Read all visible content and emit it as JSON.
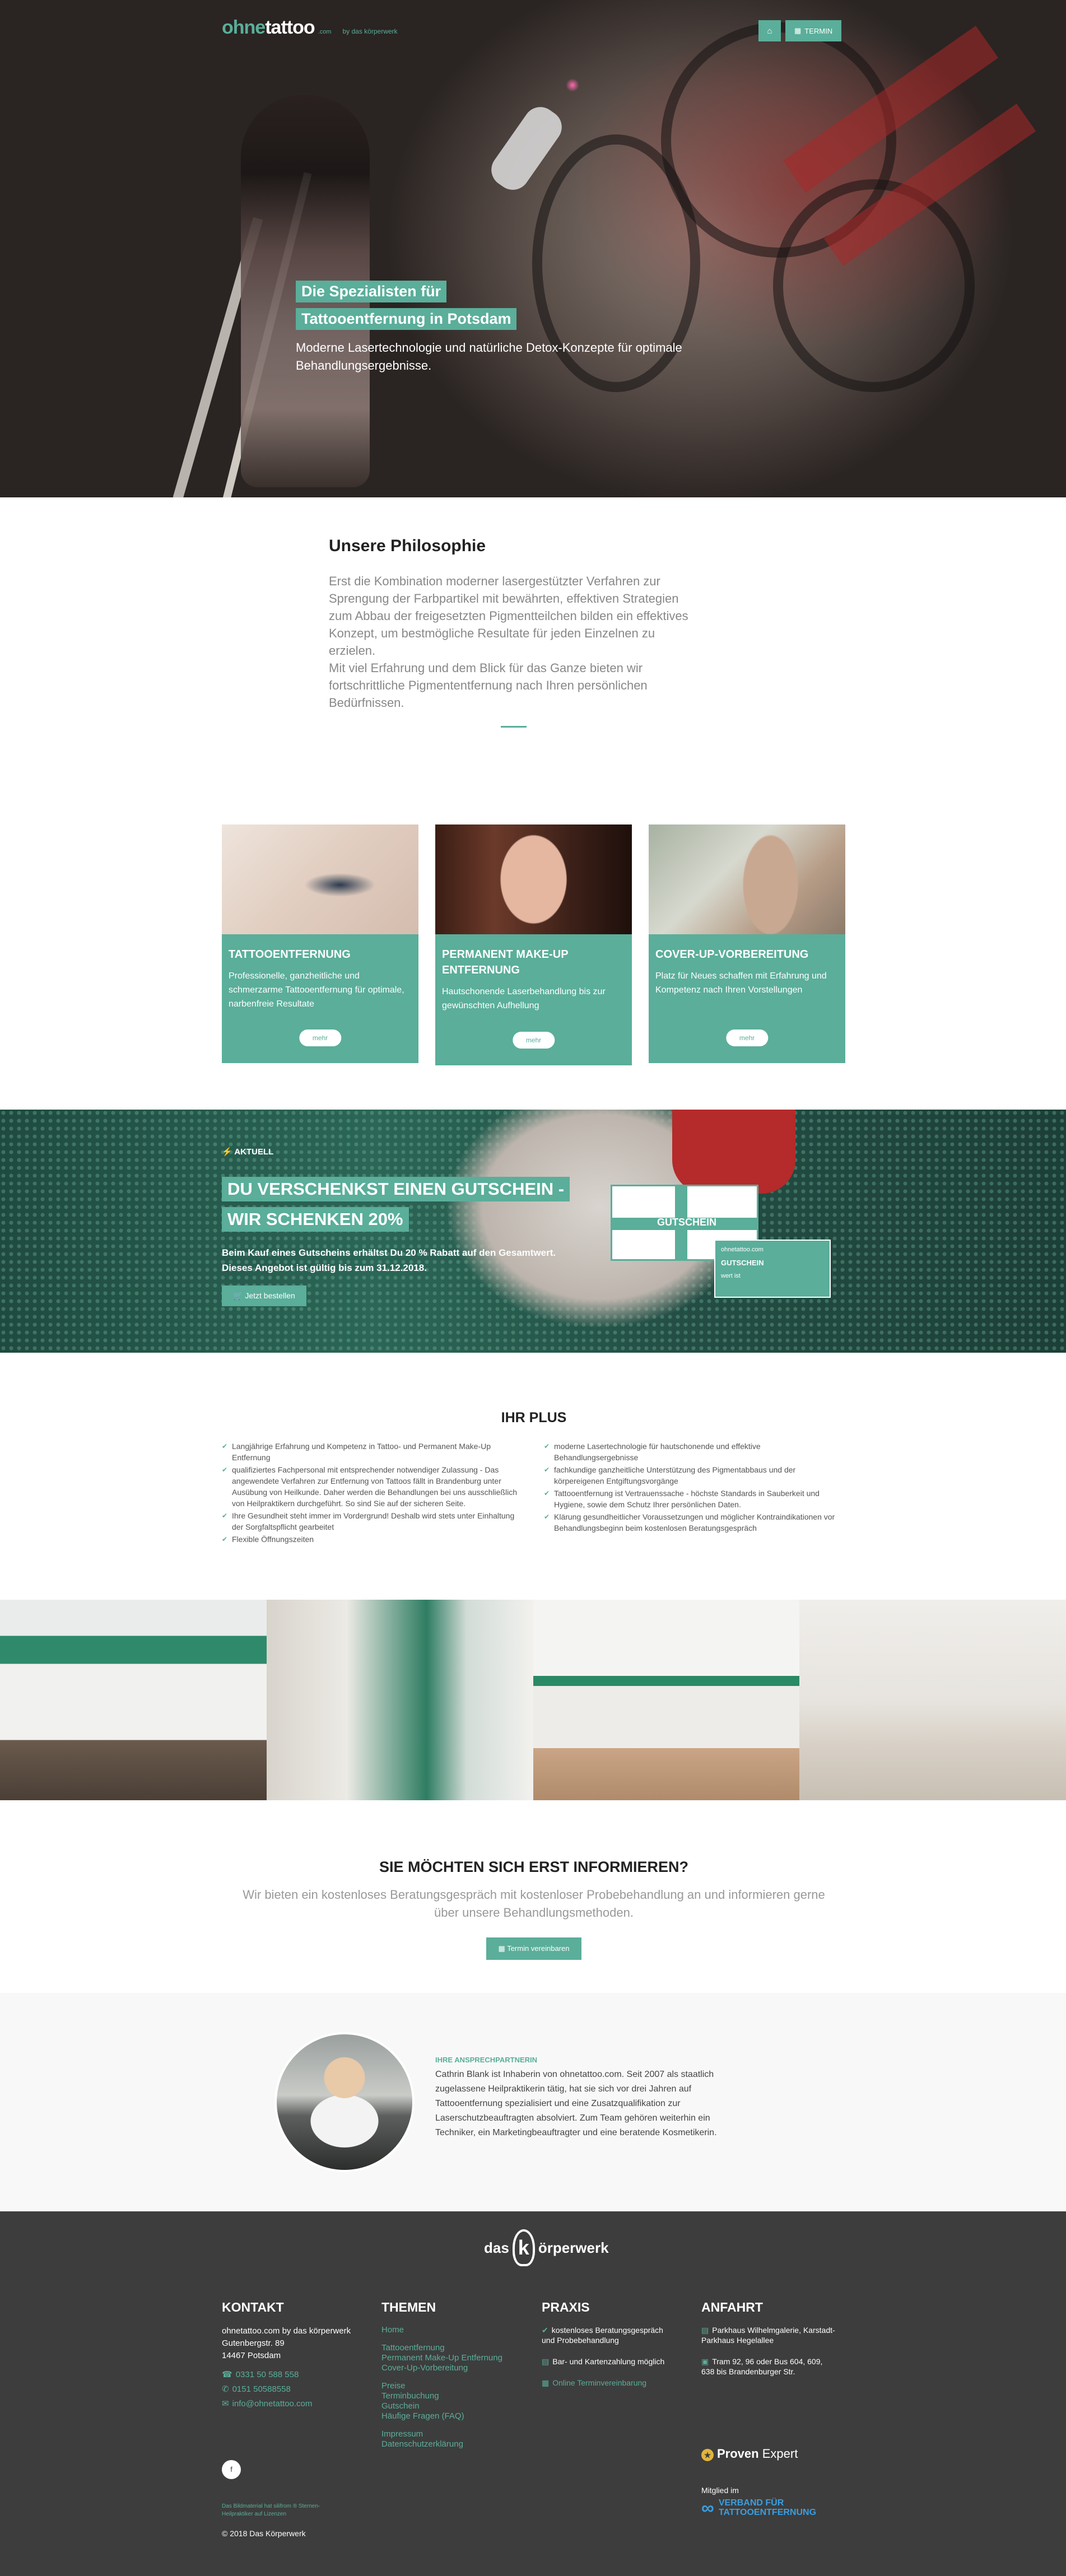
{
  "header": {
    "logo_brand_a": "ohne",
    "logo_brand_b": "tattoo",
    "logo_domain": ".com",
    "logo_by": "by das körperwerk",
    "home_icon": "home-icon",
    "termin_label": "TERMIN"
  },
  "hero": {
    "headline_1": "Die Spezialisten für",
    "headline_2": "Tattooentfernung in Potsdam",
    "subtitle": "Moderne Lasertechnologie und natürliche Detox-Konzepte für optimale Behandlungsergebnisse."
  },
  "philosophy": {
    "title": "Unsere Philosophie",
    "text_1": "Erst die Kombination moderner lasergestützter Verfahren zur Sprengung der Farbpartikel mit bewährten, effektiven Strategien zum Abbau der freigesetzten Pigmentteilchen bilden ein effektives Konzept, um bestmögliche Resultate für jeden Einzelnen zu erzielen.",
    "text_2": "Mit viel Erfahrung und dem Blick für das Ganze bieten wir fortschrittliche Pigmententfernung nach Ihren persönlichen Bedürfnissen."
  },
  "cards": [
    {
      "title": "TATTOOENTFERNUNG",
      "text": "Professionelle, ganzheitliche und schmerzarme Tattooentfernung für optimale, narbenfreie Resultate",
      "button": "mehr"
    },
    {
      "title": "PERMANENT MAKE-UP ENTFERNUNG",
      "text": "Hautschonende Laserbehandlung bis zur gewünschten Aufhellung",
      "button": "mehr"
    },
    {
      "title": "COVER-UP-VORBEREITUNG",
      "text": "Platz für Neues schaffen mit Erfahrung und Kompetenz nach Ihren Vorstellungen",
      "button": "mehr"
    }
  ],
  "gutschein": {
    "tag": "AKTUELL",
    "headline_1": "DU VERSCHENKST EINEN GUTSCHEIN -",
    "headline_2": "WIR SCHENKEN 20%",
    "desc": "Beim Kauf eines Gutscheins erhältst Du 20 % Rabatt auf den Gesamtwert. Dieses Angebot ist gültig bis zum 31.12.2018.",
    "order_label": "Jetzt bestellen",
    "voucher_text": "GUTSCHEIN",
    "card_brand": "ohnetattoo.com",
    "card_label": "GUTSCHEIN",
    "card_sub": "wert ist"
  },
  "plus": {
    "title": "IHR PLUS",
    "left": [
      "Langjährige Erfahrung und Kompetenz in Tattoo- und Permanent Make-Up Entfernung",
      "qualifiziertes Fachpersonal mit entsprechender notwendiger Zulassung - Das angewendete Verfahren zur Entfernung von Tattoos fällt in Brandenburg unter Ausübung von Heilkunde. Daher werden die Behandlungen bei uns ausschließlich von Heilpraktikern durchgeführt. So sind Sie auf der sicheren Seite.",
      "Ihre Gesundheit steht immer im Vordergrund! Deshalb wird stets unter Einhaltung der Sorgfaltspflicht gearbeitet",
      "Flexible Öffnungszeiten"
    ],
    "right": [
      "moderne Lasertechnologie für hautschonende und effektive Behandlungsergebnisse",
      "fachkundige ganzheitliche Unterstützung des Pigmentabbaus und der körpereigenen Entgiftungsvorgänge",
      "Tattooentfernung ist Vertrauenssache - höchste Standards in Sauberkeit und Hygiene, sowie dem Schutz Ihrer persönlichen Daten.",
      "Klärung gesundheitlicher Voraussetzungen und möglicher Kontraindikationen vor Behandlungsbeginn beim kostenlosen Beratungsgespräch"
    ]
  },
  "inform": {
    "title": "SIE MÖCHTEN SICH ERST INFORMIEREN?",
    "text": "Wir bieten ein kostenloses Beratungsgespräch mit kostenloser Probebehandlung an und informieren gerne über unsere Behandlungsmethoden.",
    "cta": "Termin vereinbaren"
  },
  "contact": {
    "label": "IHRE ANSPRECHPARTNERIN",
    "text": "Cathrin Blank ist Inhaberin von ohnetattoo.com. Seit 2007 als staatlich zugelassene Heilpraktikerin tätig, hat sie sich vor drei Jahren auf Tattooentfernung spezialisiert und eine Zusatzqualifikation zur Laserschutzbeauftragten absolviert. Zum Team gehören weiterhin ein Techniker, ein Marketingbeauftragter und eine beratende Kosmetikerin."
  },
  "footer": {
    "logo_das": "das",
    "logo_k": "k",
    "logo_rest": "örperwerk",
    "kontakt": {
      "title": "KONTAKT",
      "line1": "ohnetattoo.com by das körperwerk",
      "line2": "Gutenbergstr. 89",
      "line3": "14467 Potsdam",
      "phone": "0331 50 588 558",
      "whatsapp": "0151 50588558",
      "email": "info@ohnetattoo.com"
    },
    "themen": {
      "title": "THEMEN",
      "items_a": [
        "Home"
      ],
      "items_b": [
        "Tattooentfernung",
        "Permanent Make-Up Entfernung",
        "Cover-Up-Vorbereitung"
      ],
      "items_c": [
        "Preise",
        "Terminbuchung",
        "Gutschein",
        "Häufige Fragen (FAQ)"
      ],
      "items_d": [
        "Impressum",
        "Datenschutzerklärung"
      ]
    },
    "praxis": {
      "title": "PRAXIS",
      "item1": "kostenloses Beratungsgespräch und Probebehandlung",
      "item2": "Bar- und Kartenzahlung möglich",
      "item3": "Online Terminvereinbarung"
    },
    "anfahrt": {
      "title": "ANFAHRT",
      "item1": "Parkhaus Wilhelmgalerie, Karstadt-Parkhaus Hegelallee",
      "item2": "Tram 92, 96 oder Bus 604, 609, 638 bis Brandenburger Str."
    },
    "proven": "Proven",
    "proven_b": "Expert",
    "verband_member": "Mitglied im",
    "verband_1": "VERBAND FÜR",
    "verband_2": "TATTOOENTFERNUNG",
    "small_note": "Das Bildmaterial hat silifrom ® Sternen-Heilpraktiker auf Lizenzen",
    "copyright": "© 2018 Das Körperwerk",
    "fb": "f"
  }
}
